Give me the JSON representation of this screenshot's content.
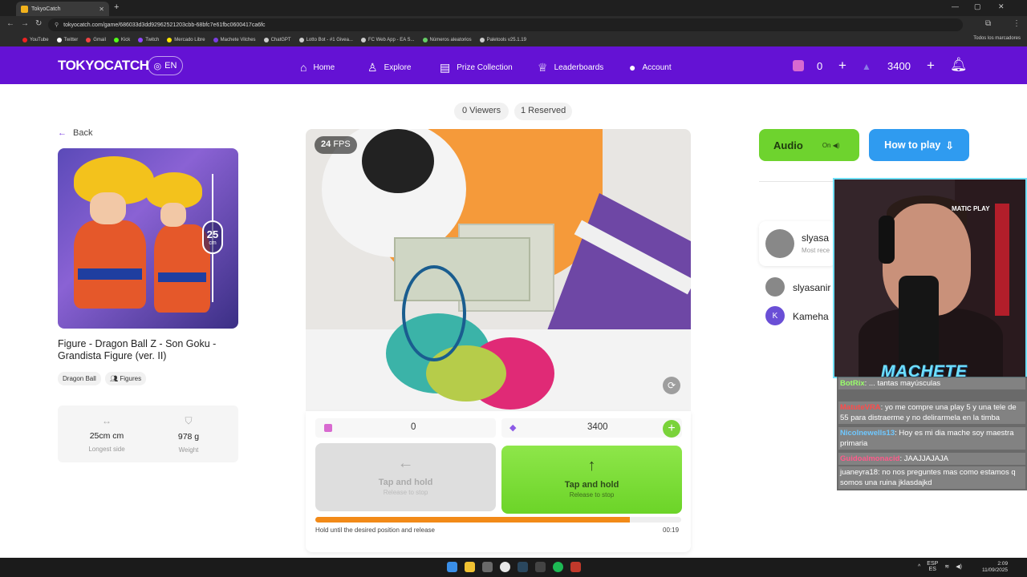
{
  "browser": {
    "tab_title": "TokyoCatch",
    "url": "tokyocatch.com/game/686033d3dd92962521203cbb-68bfc7e61fbc0600417ca6fc",
    "bookmarks": [
      "YouTube",
      "Twitter",
      "Gmail",
      "Kick",
      "Twitch",
      "Mercado Libre",
      "Machete Vilches",
      "ChatGPT",
      "Lotto Bot - #1 Givea...",
      "FC Web App - EA S...",
      "Números aleatorios",
      "Paletools v25.1.19"
    ],
    "bookmarks_all": "Todos los marcadores"
  },
  "header": {
    "logo": "TOKYOCATCH",
    "lang": "EN",
    "nav": [
      {
        "label": "Home",
        "icon": "home-icon"
      },
      {
        "label": "Explore",
        "icon": "explore-icon"
      },
      {
        "label": "Prize Collection",
        "icon": "collection-icon"
      },
      {
        "label": "Leaderboards",
        "icon": "trophy-icon"
      },
      {
        "label": "Account",
        "icon": "account-icon"
      }
    ],
    "coins": "0",
    "gems": "3400"
  },
  "status": {
    "viewers": "0 Viewers",
    "reserved": "1 Reserved"
  },
  "prize": {
    "back": "Back",
    "size_number": "25",
    "size_unit": "cm",
    "title": "Figure - Dragon Ball Z - Son Goku - Grandista Figure (ver. II)",
    "tags": [
      "Dragon Ball",
      "Figures"
    ],
    "specs": [
      {
        "value": "25cm cm",
        "label": "Longest side"
      },
      {
        "value": "978 g",
        "label": "Weight"
      }
    ]
  },
  "game": {
    "fps_number": "24",
    "fps_unit": "FPS",
    "balance_coins": "0",
    "balance_gems": "3400",
    "left_button": {
      "label": "Tap and hold",
      "sub": "Release to stop"
    },
    "right_button": {
      "label": "Tap and hold",
      "sub": "Release to stop"
    },
    "progress": 0.86,
    "hint": "Hold until the desired position and release",
    "timer": "00:19"
  },
  "side": {
    "audio_label": "Audio",
    "audio_state": "On",
    "howto_label": "How to play",
    "queue": [
      {
        "name": "slyasa",
        "sub": "Most rece"
      },
      {
        "name": "slyasanir"
      },
      {
        "name": "Kameha",
        "initial": "K"
      }
    ]
  },
  "stream": {
    "brand": "MATIC PLAY",
    "streamer": "MACHETE",
    "chat": [
      {
        "user": "BotRix",
        "text": ": ... tantas mayúsculas",
        "color": "#9aff6a"
      },
      {
        "user": "MatuteVRA",
        "text": ": yo me compre una play 5 y una tele de 55 para distraerme y no delirarmela en la timba",
        "color": "#ff4a4a"
      },
      {
        "user": "Nicolnewells13",
        "text": ": Hoy es mi dia mache soy maestra primaria",
        "color": "#6fc8ff"
      },
      {
        "user": "Guidoalmonacid",
        "text": ": JAAJJAJAJA",
        "color": "#ff5a8a"
      },
      {
        "user": "juaneyra18",
        "text": ": no nos preguntes mas como estamos q somos una ruina jklasdajkd",
        "color": "#ffffff"
      }
    ]
  },
  "system": {
    "lang_code": "ESP",
    "lang_sub": "ES",
    "time": "2:09",
    "date": "11/09/2025"
  }
}
